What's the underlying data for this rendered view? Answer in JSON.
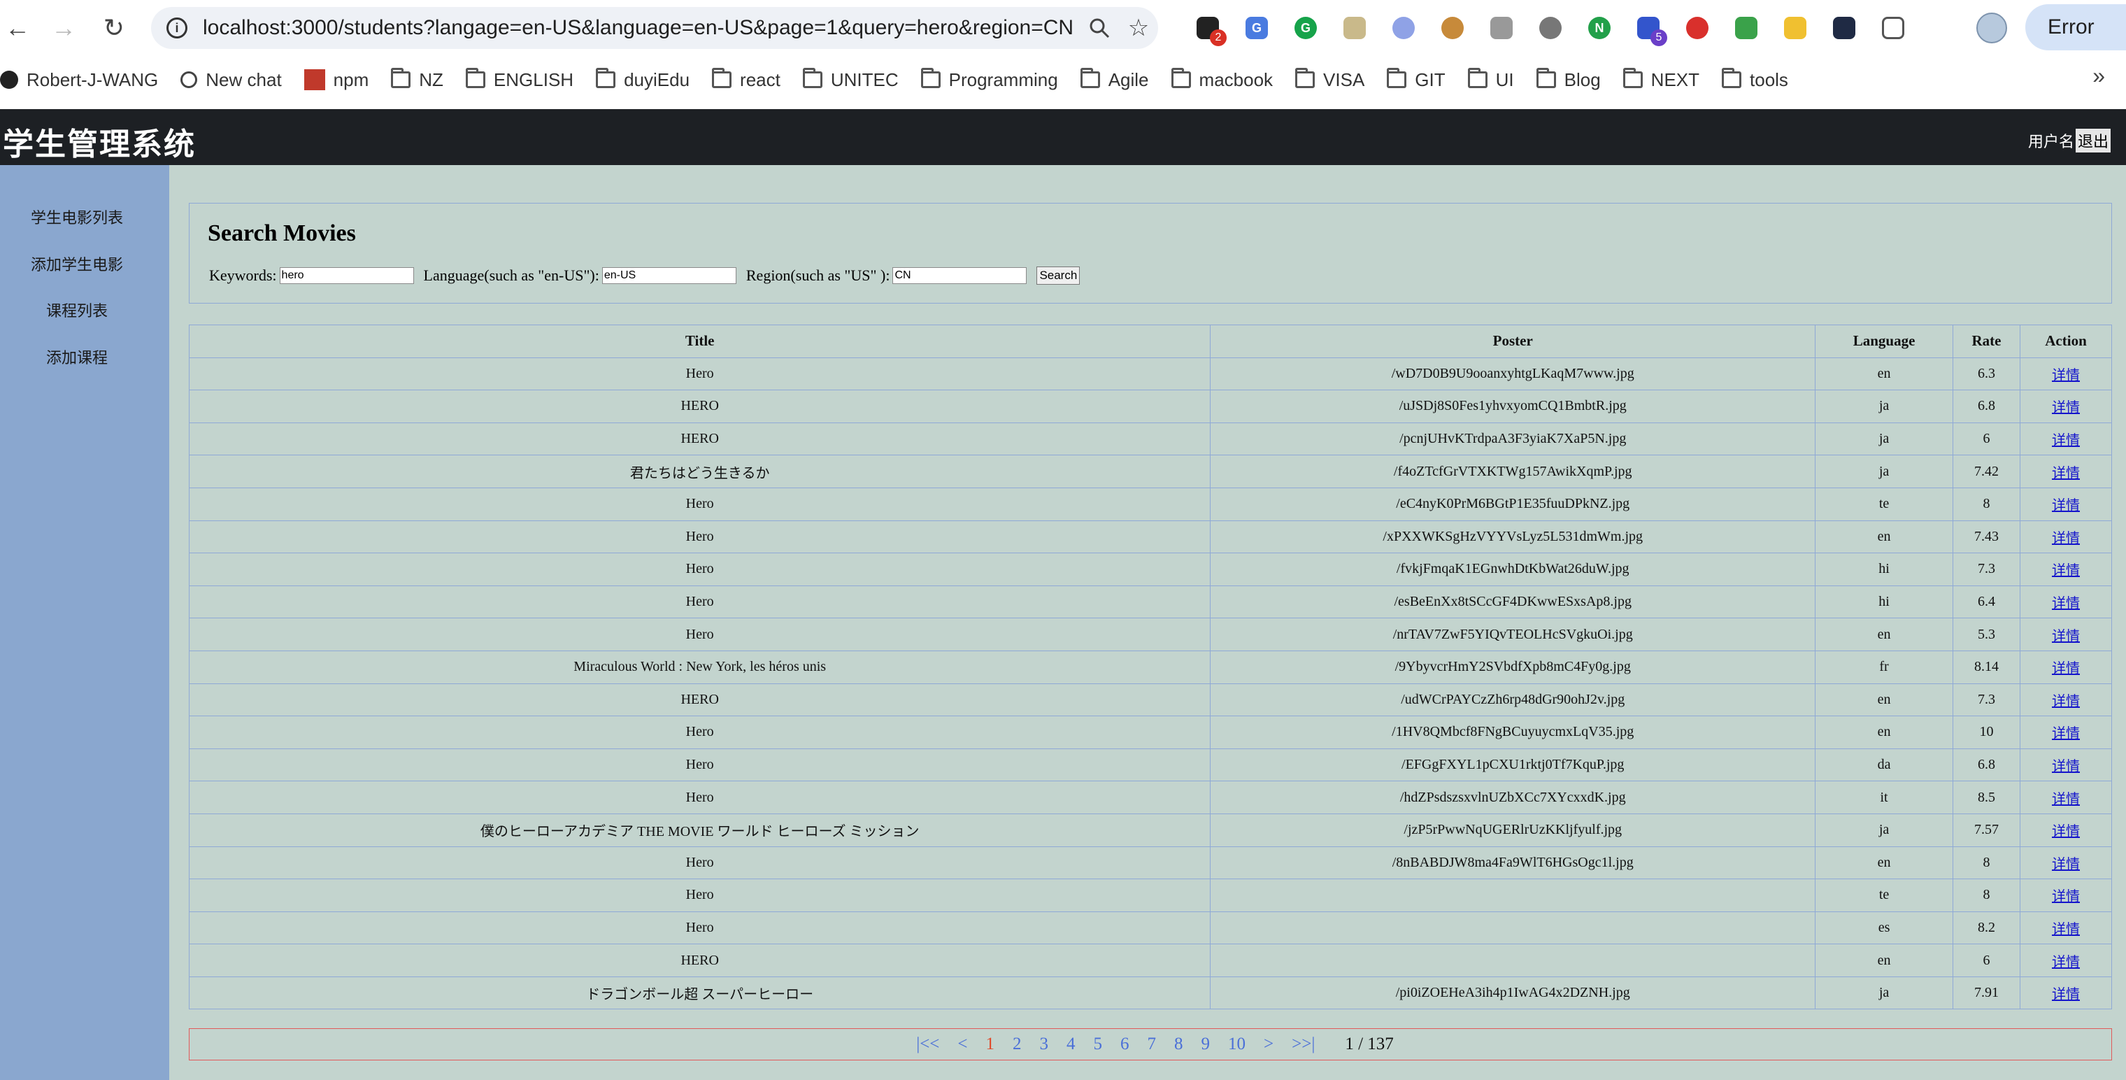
{
  "browser": {
    "url": "localhost:3000/students?langage=en-US&language=en-US&page=1&query=hero&region=CN",
    "error_label": "Error",
    "extension_badges": [
      "2",
      "5"
    ],
    "bookmarks": [
      {
        "label": "Robert-J-WANG",
        "icon": "github-icon"
      },
      {
        "label": "New chat",
        "icon": "openai-icon"
      },
      {
        "label": "npm",
        "icon": "npm-icon"
      },
      {
        "label": "NZ",
        "icon": "folder-icon"
      },
      {
        "label": "ENGLISH",
        "icon": "folder-icon"
      },
      {
        "label": "duyiEdu",
        "icon": "folder-icon"
      },
      {
        "label": "react",
        "icon": "folder-icon"
      },
      {
        "label": "UNITEC",
        "icon": "folder-icon"
      },
      {
        "label": "Programming",
        "icon": "folder-icon"
      },
      {
        "label": "Agile",
        "icon": "folder-icon"
      },
      {
        "label": "macbook",
        "icon": "folder-icon"
      },
      {
        "label": "VISA",
        "icon": "folder-icon"
      },
      {
        "label": "GIT",
        "icon": "folder-icon"
      },
      {
        "label": "UI",
        "icon": "folder-icon"
      },
      {
        "label": "Blog",
        "icon": "folder-icon"
      },
      {
        "label": "NEXT",
        "icon": "folder-icon"
      },
      {
        "label": "tools",
        "icon": "folder-icon"
      }
    ]
  },
  "header": {
    "title": "学生管理系统",
    "user_label": "用户名",
    "logout_label": "退出"
  },
  "sidebar": {
    "items": [
      {
        "label": "学生电影列表"
      },
      {
        "label": "添加学生电影"
      },
      {
        "label": "课程列表"
      },
      {
        "label": "添加课程"
      }
    ]
  },
  "search": {
    "title": "Search Movies",
    "keywords_label": "Keywords:",
    "keywords_value": "hero",
    "language_label": "Language(such as \"en-US\"):",
    "language_value": "en-US",
    "region_label": "Region(such as \"US\" ):",
    "region_value": "CN",
    "button_label": "Search"
  },
  "table": {
    "columns": [
      "Title",
      "Poster",
      "Language",
      "Rate",
      "Action"
    ],
    "action_label": "详情",
    "rows": [
      {
        "title": "Hero",
        "poster": "/wD7D0B9U9ooanxyhtgLKaqM7www.jpg",
        "language": "en",
        "rate": "6.3"
      },
      {
        "title": "HERO",
        "poster": "/uJSDj8S0Fes1yhvxyomCQ1BmbtR.jpg",
        "language": "ja",
        "rate": "6.8"
      },
      {
        "title": "HERO",
        "poster": "/pcnjUHvKTrdpaA3F3yiaK7XaP5N.jpg",
        "language": "ja",
        "rate": "6"
      },
      {
        "title": "君たちはどう生きるか",
        "poster": "/f4oZTcfGrVTXKTWg157AwikXqmP.jpg",
        "language": "ja",
        "rate": "7.42"
      },
      {
        "title": "Hero",
        "poster": "/eC4nyK0PrM6BGtP1E35fuuDPkNZ.jpg",
        "language": "te",
        "rate": "8"
      },
      {
        "title": "Hero",
        "poster": "/xPXXWKSgHzVYYVsLyz5L531dmWm.jpg",
        "language": "en",
        "rate": "7.43"
      },
      {
        "title": "Hero",
        "poster": "/fvkjFmqaK1EGnwhDtKbWat26duW.jpg",
        "language": "hi",
        "rate": "7.3"
      },
      {
        "title": "Hero",
        "poster": "/esBeEnXx8tSCcGF4DKwwESxsAp8.jpg",
        "language": "hi",
        "rate": "6.4"
      },
      {
        "title": "Hero",
        "poster": "/nrTAV7ZwF5YIQvTEOLHcSVgkuOi.jpg",
        "language": "en",
        "rate": "5.3"
      },
      {
        "title": "Miraculous World : New York, les héros unis",
        "poster": "/9YbyvcrHmY2SVbdfXpb8mC4Fy0g.jpg",
        "language": "fr",
        "rate": "8.14"
      },
      {
        "title": "HERO",
        "poster": "/udWCrPAYCzZh6rp48dGr90ohJ2v.jpg",
        "language": "en",
        "rate": "7.3"
      },
      {
        "title": "Hero",
        "poster": "/1HV8QMbcf8FNgBCuyuycmxLqV35.jpg",
        "language": "en",
        "rate": "10"
      },
      {
        "title": "Hero",
        "poster": "/EFGgFXYL1pCXU1rktj0Tf7KquP.jpg",
        "language": "da",
        "rate": "6.8"
      },
      {
        "title": "Hero",
        "poster": "/hdZPsdszsxvlnUZbXCc7XYcxxdK.jpg",
        "language": "it",
        "rate": "8.5"
      },
      {
        "title": "僕のヒーローアカデミア THE MOVIE ワールド ヒーローズ ミッション",
        "poster": "/jzP5rPwwNqUGERlrUzKKljfyulf.jpg",
        "language": "ja",
        "rate": "7.57"
      },
      {
        "title": "Hero",
        "poster": "/8nBABDJW8ma4Fa9WlT6HGsOgc1l.jpg",
        "language": "en",
        "rate": "8"
      },
      {
        "title": "Hero",
        "poster": "",
        "language": "te",
        "rate": "8"
      },
      {
        "title": "Hero",
        "poster": "",
        "language": "es",
        "rate": "8.2"
      },
      {
        "title": "HERO",
        "poster": "",
        "language": "en",
        "rate": "6"
      },
      {
        "title": "ドラゴンボール超 スーパーヒーロー",
        "poster": "/pi0iZOEHeA3ih4p1IwAG4x2DZNH.jpg",
        "language": "ja",
        "rate": "7.91"
      }
    ]
  },
  "pagination": {
    "first": "|<<",
    "prev": "<",
    "pages": [
      "1",
      "2",
      "3",
      "4",
      "5",
      "6",
      "7",
      "8",
      "9",
      "10"
    ],
    "current": "1",
    "next": ">",
    "last": ">>|",
    "total": "1 / 137"
  }
}
